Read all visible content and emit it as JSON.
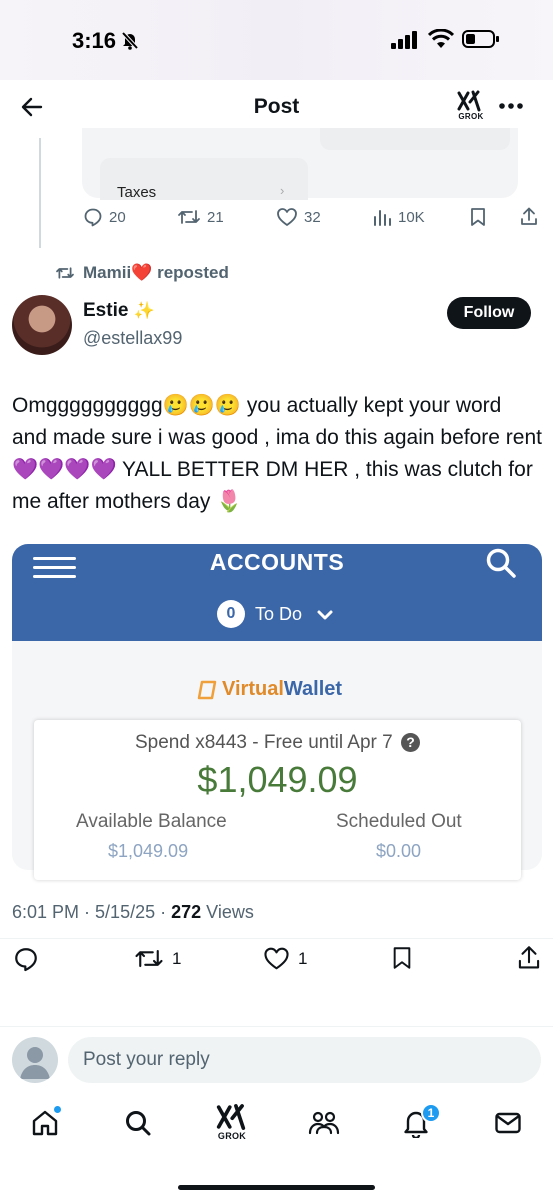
{
  "status_bar": {
    "time": "3:16"
  },
  "header": {
    "title": "Post",
    "grok_label": "GROK"
  },
  "previous_post": {
    "card_item": "Taxes",
    "actions": {
      "replies": "20",
      "reposts": "21",
      "likes": "32",
      "views": "10K"
    }
  },
  "repost_notice": {
    "reposter": "Mamii",
    "heart_emoji": "❤️",
    "label": "reposted"
  },
  "author": {
    "name": "Estie",
    "sparkle": "✨",
    "handle": "@estellax99",
    "follow_label": "Follow"
  },
  "tweet": {
    "text": "Omgggggggggg🥲🥲🥲 you actually kept your word and made sure i was good , ima do this again before rent 💜💜💜💜 YALL BETTER DM HER , this was clutch for me after mothers day 🌷"
  },
  "embedded_image": {
    "title": "ACCOUNTS",
    "todo_count": "0",
    "todo_label": "To Do",
    "brand_virtual": "Virtual",
    "brand_wallet": "Wallet",
    "account_label": "Spend x8443 - Free until Apr 7",
    "balance": "$1,049.09",
    "available_label": "Available Balance",
    "available_value": "$1,049.09",
    "scheduled_label": "Scheduled Out",
    "scheduled_value": "$0.00"
  },
  "meta": {
    "time": "6:01 PM",
    "date": "5/15/25",
    "views_count": "272",
    "views_label": "Views"
  },
  "actions": {
    "reposts": "1",
    "likes": "1"
  },
  "reply": {
    "placeholder": "Post your reply"
  },
  "bottom_nav": {
    "grok_label": "GROK",
    "notifications_badge": "1"
  },
  "colors": {
    "accent": "#1d9bf0",
    "bank_blue": "#3b67a9",
    "balance_green": "#487a3a",
    "text_primary": "#0f1419",
    "text_secondary": "#536471"
  }
}
